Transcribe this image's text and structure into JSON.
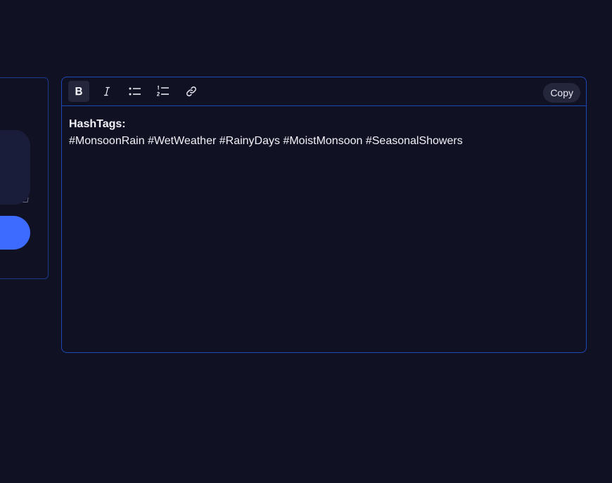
{
  "left_panel": {
    "textarea_value": "",
    "button_label": ""
  },
  "editor": {
    "toolbar": {
      "bold_icon": "bold-icon",
      "italic_icon": "italic-icon",
      "bullet_list_icon": "bullet-list-icon",
      "numbered_list_icon": "numbered-list-icon",
      "link_icon": "link-icon",
      "copy_label": "Copy"
    },
    "content": {
      "heading": "HashTags:",
      "body": "#MonsoonRain #WetWeather #RainyDays #MoistMonsoon #SeasonalShowers"
    }
  },
  "colors": {
    "background": "#111124",
    "border": "#1e48b4",
    "accent": "#3d6bff",
    "button_bg": "#24263b",
    "text": "#f1f2f8"
  }
}
